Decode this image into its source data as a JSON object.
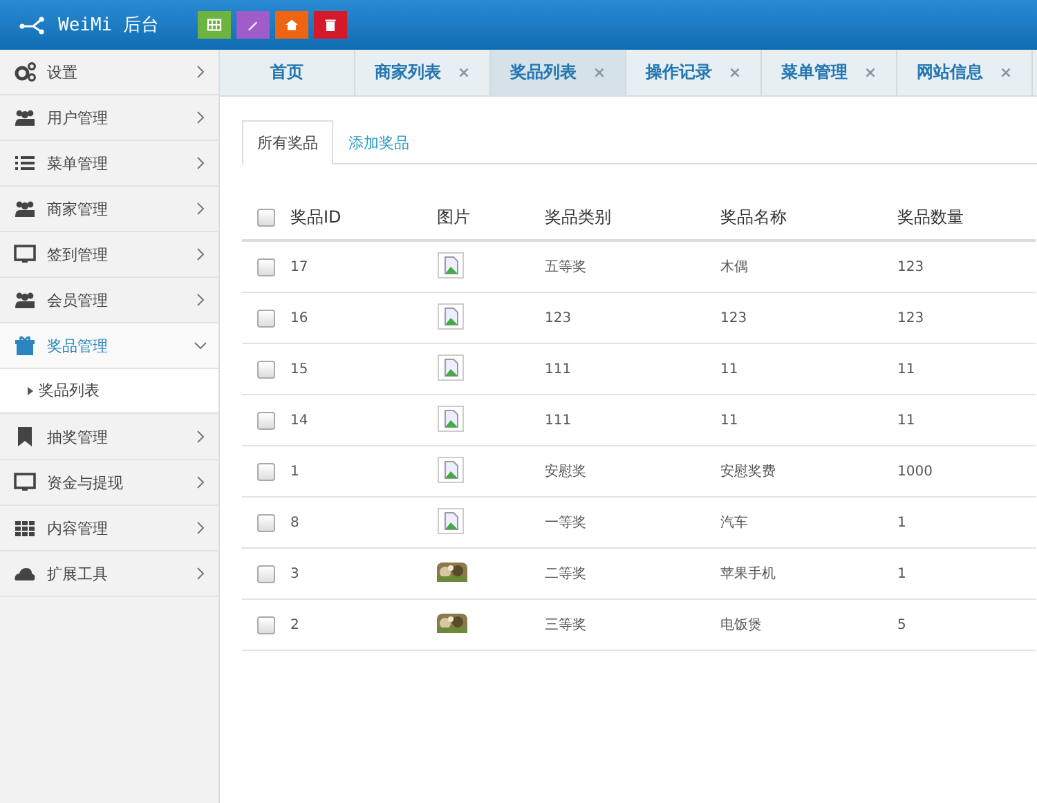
{
  "header": {
    "brand": "WeiMi 后台"
  },
  "sidebar": {
    "items": [
      {
        "label": "设置",
        "selected": false,
        "expanded": false
      },
      {
        "label": "用户管理",
        "selected": false,
        "expanded": false
      },
      {
        "label": "菜单管理",
        "selected": false,
        "expanded": false
      },
      {
        "label": "商家管理",
        "selected": false,
        "expanded": false
      },
      {
        "label": "签到管理",
        "selected": false,
        "expanded": false
      },
      {
        "label": "会员管理",
        "selected": false,
        "expanded": false
      },
      {
        "label": "奖品管理",
        "selected": true,
        "expanded": true,
        "children": [
          {
            "label": "奖品列表"
          }
        ]
      },
      {
        "label": "抽奖管理",
        "selected": false,
        "expanded": false
      },
      {
        "label": "资金与提现",
        "selected": false,
        "expanded": false
      },
      {
        "label": "内容管理",
        "selected": false,
        "expanded": false
      },
      {
        "label": "扩展工具",
        "selected": false,
        "expanded": false
      }
    ]
  },
  "tabs": [
    {
      "label": "首页",
      "selected": false
    },
    {
      "label": "商家列表",
      "selected": false,
      "close": "×"
    },
    {
      "label": "奖品列表",
      "selected": true,
      "close": "×"
    },
    {
      "label": "操作记录",
      "selected": false,
      "close": "×"
    },
    {
      "label": "菜单管理",
      "selected": false,
      "close": "×"
    },
    {
      "label": "网站信息",
      "selected": false,
      "close": "×"
    }
  ],
  "subtabs": [
    {
      "label": "所有奖品",
      "selected": true
    },
    {
      "label": "添加奖品",
      "selected": false
    }
  ],
  "table": {
    "columns": [
      "奖品ID",
      "图片",
      "奖品类别",
      "奖品名称",
      "奖品数量"
    ],
    "header_checked": false,
    "rows": [
      {
        "checked": false,
        "id": "17",
        "kind": "broken",
        "category": "五等奖",
        "name": "木偶",
        "quantity": "123"
      },
      {
        "checked": false,
        "id": "16",
        "kind": "broken",
        "category": "123",
        "name": "123",
        "quantity": "123"
      },
      {
        "checked": false,
        "id": "15",
        "kind": "broken",
        "category": "111",
        "name": "11",
        "quantity": "11"
      },
      {
        "checked": false,
        "id": "14",
        "kind": "broken",
        "category": "111",
        "name": "11",
        "quantity": "11"
      },
      {
        "checked": false,
        "id": "1",
        "kind": "broken",
        "category": "安慰奖",
        "name": "安慰奖费",
        "quantity": "1000"
      },
      {
        "checked": false,
        "id": "8",
        "kind": "broken",
        "category": "一等奖",
        "name": "汽车",
        "quantity": "1"
      },
      {
        "checked": false,
        "id": "3",
        "kind": "picture",
        "category": "二等奖",
        "name": "苹果手机",
        "quantity": "1"
      },
      {
        "checked": false,
        "id": "2",
        "kind": "picture",
        "category": "三等奖",
        "name": "电饭煲",
        "quantity": "5"
      }
    ]
  }
}
